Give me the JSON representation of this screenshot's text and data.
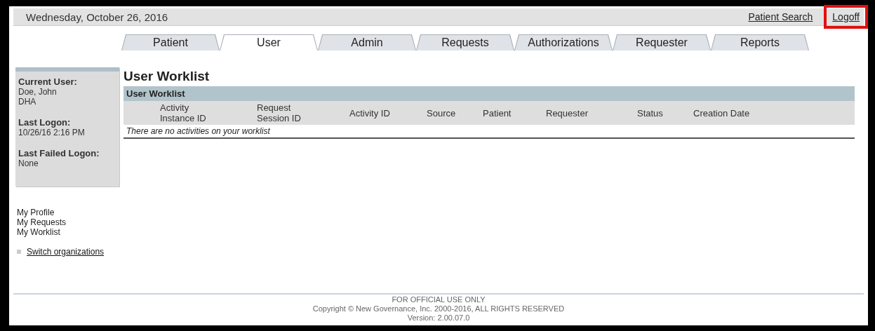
{
  "top_bar": {
    "date": "Wednesday, October 26, 2016",
    "links": [
      {
        "label": "Patient Search",
        "highlighted": false
      },
      {
        "label": "Logoff",
        "highlighted": true
      }
    ]
  },
  "tabs": [
    {
      "label": "Patient",
      "selected": false
    },
    {
      "label": "User",
      "selected": true
    },
    {
      "label": "Admin",
      "selected": false
    },
    {
      "label": "Requests",
      "selected": false
    },
    {
      "label": "Authorizations",
      "selected": false
    },
    {
      "label": "Requester",
      "selected": false
    },
    {
      "label": "Reports",
      "selected": false
    }
  ],
  "sidebar": {
    "info": [
      {
        "label": "Current User:",
        "values": [
          "Doe, John",
          "DHA"
        ]
      },
      {
        "label": "Last Logon:",
        "values": [
          "10/26/16 2:16 PM"
        ]
      },
      {
        "label": "Last Failed Logon:",
        "values": [
          "None"
        ]
      }
    ],
    "links": [
      "My Profile",
      "My Requests",
      "My Worklist"
    ],
    "switch_link": "Switch organizations"
  },
  "main": {
    "title": "User Worklist",
    "table": {
      "caption": "User Worklist",
      "columns": [
        [
          "Activity",
          "Instance ID"
        ],
        [
          "Request",
          "Session ID"
        ],
        [
          "Activity ID"
        ],
        [
          "Source"
        ],
        [
          "Patient"
        ],
        [
          "Requester"
        ],
        [
          "Status"
        ],
        [
          "Creation Date"
        ]
      ],
      "empty_message": "There are no activities on your worklist"
    }
  },
  "footer": [
    "FOR OFFICIAL USE ONLY",
    "Copyright © New Governance, Inc. 2000-2016, ALL RIGHTS RESERVED",
    "Version: 2.00.07.0"
  ]
}
